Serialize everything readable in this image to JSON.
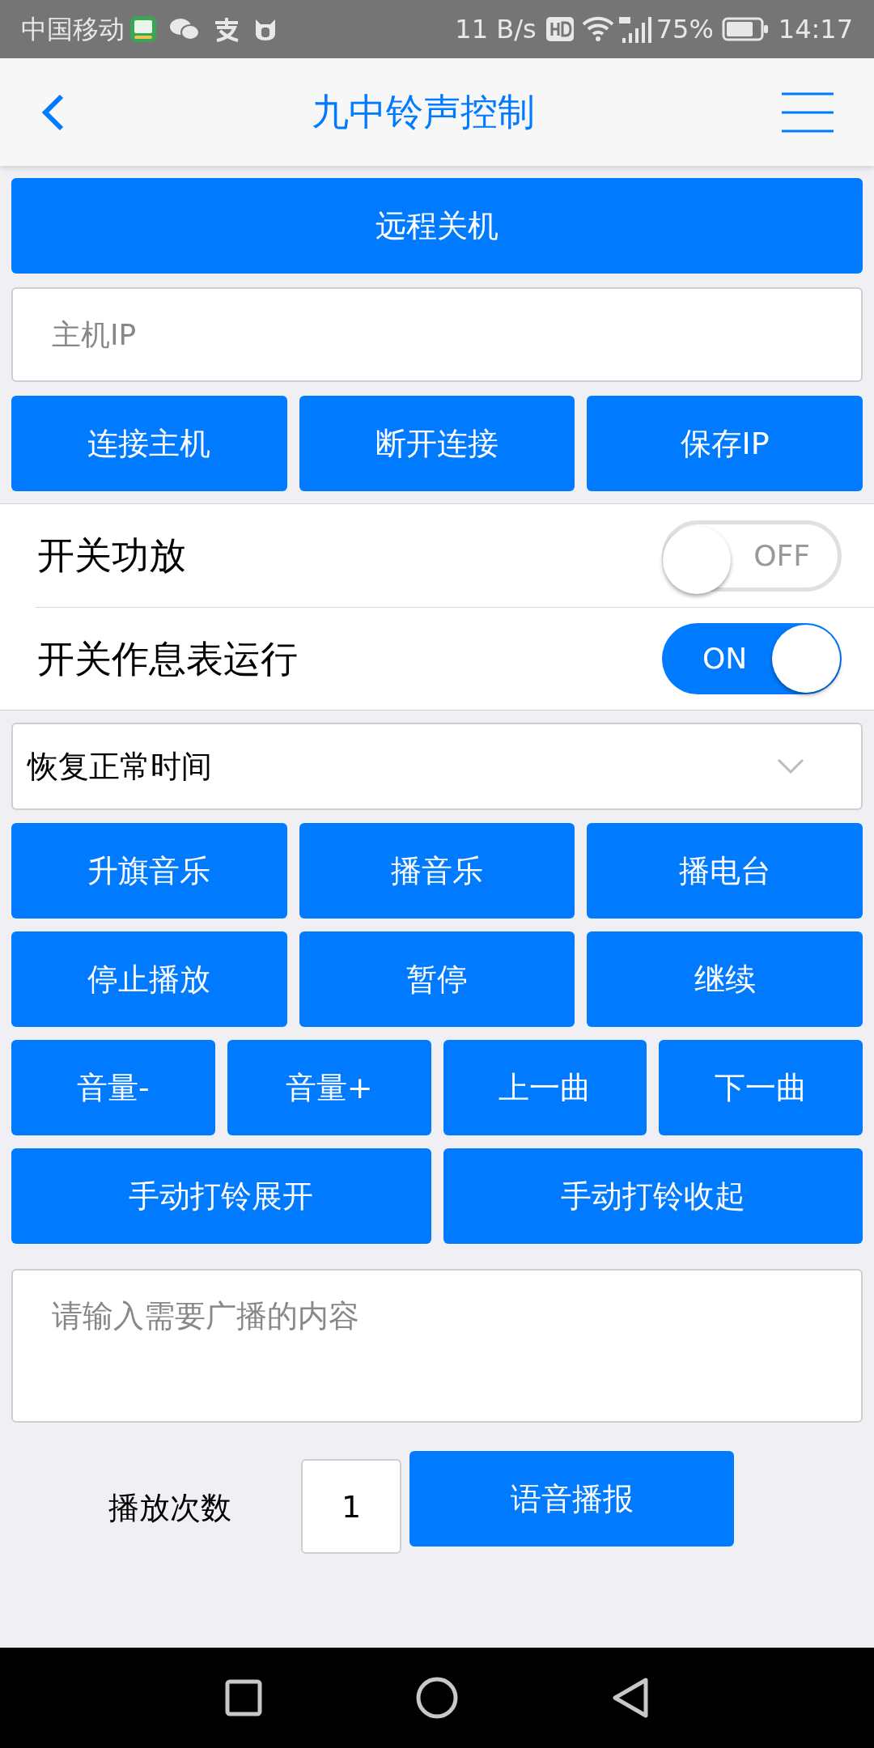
{
  "status_bar": {
    "carrier": "中国移动",
    "net_speed": "11 B/s",
    "battery": "75%",
    "time": "14:17"
  },
  "header": {
    "title": "九中铃声控制"
  },
  "shutdown_button": "远程关机",
  "ip_field": {
    "placeholder": "主机IP"
  },
  "ip_buttons": [
    "连接主机",
    "断开连接",
    "保存IP"
  ],
  "switches": [
    {
      "label": "开关功放",
      "on": false,
      "state_text": "OFF"
    },
    {
      "label": "开关作息表运行",
      "on": true,
      "state_text": "ON"
    }
  ],
  "schedule_select": {
    "value": "恢复正常时间"
  },
  "button_rows": [
    [
      "升旗音乐",
      "播音乐",
      "播电台"
    ],
    [
      "停止播放",
      "暂停",
      "继续"
    ],
    [
      "音量-",
      "音量+",
      "上一曲",
      "下一曲"
    ],
    [
      "手动打铃展开",
      "手动打铃收起"
    ]
  ],
  "broadcast_field": {
    "placeholder": "请输入需要广播的内容"
  },
  "play_count": {
    "label": "播放次数",
    "value": "1"
  },
  "speak_button": "语音播报"
}
